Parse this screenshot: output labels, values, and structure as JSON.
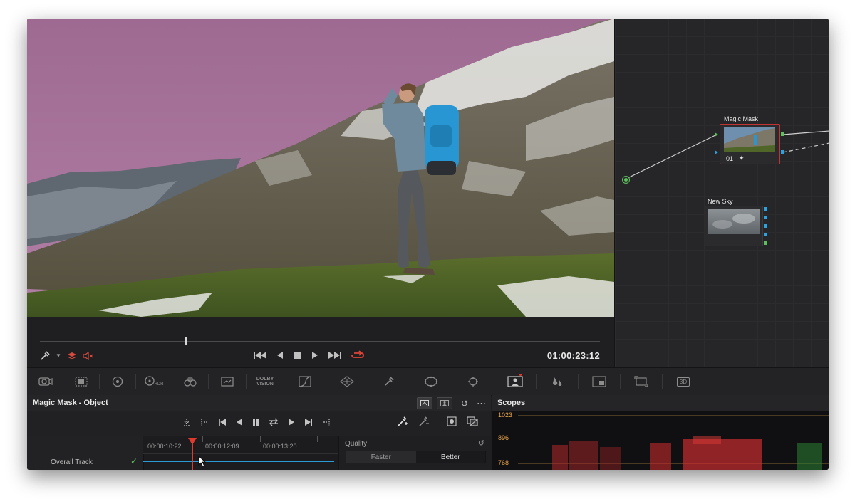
{
  "viewer": {
    "timecode": "01:00:23:12"
  },
  "nodes": {
    "magic_mask": {
      "label": "Magic Mask",
      "number": "01"
    },
    "new_sky": {
      "label": "New Sky"
    }
  },
  "palette": {
    "dolby_label_1": "DOLBY",
    "dolby_label_2": "VISION",
    "hdr_label": "HDR",
    "stereo_label": "3D"
  },
  "magic_mask_panel": {
    "title": "Magic Mask - Object",
    "ruler": [
      "00:00:10:22",
      "00:00:12:09",
      "00:00:13:20"
    ],
    "track_label": "Overall Track",
    "quality": {
      "label": "Quality",
      "options": [
        "Faster",
        "Better"
      ],
      "selected": "Better"
    }
  },
  "scopes": {
    "title": "Scopes",
    "scale": [
      "1023",
      "896",
      "768"
    ]
  },
  "colors": {
    "sky_mask": "#a8739c",
    "selected_node": "#c23434",
    "playhead": "#e03a2f",
    "track": "#2a9bd6",
    "scope_scale": "#e6a44a"
  }
}
